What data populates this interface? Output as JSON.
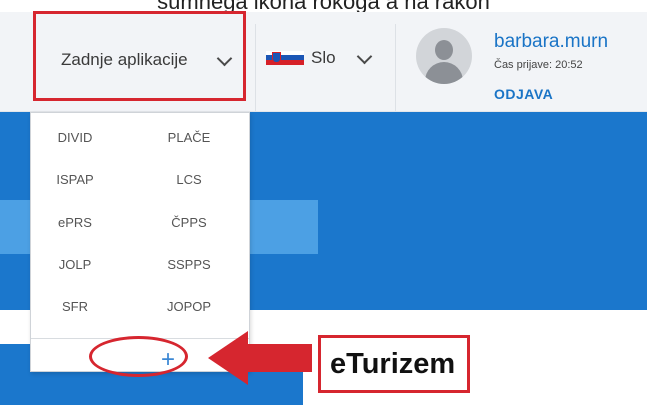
{
  "caption": "sumnega ikona rokoga a na rakon",
  "header": {
    "recent_apps_label": "Zadnje aplikacije",
    "language_label": "Slo",
    "user": {
      "username": "barbara.murn",
      "login_time": "Čas prijave: 20:52",
      "logout_label": "ODJAVA"
    }
  },
  "dropdown": {
    "apps": [
      "DIVID",
      "PLAČE",
      "ISPAP",
      "LCS",
      "ePRS",
      "ČPPS",
      "JOLP",
      "SSPPS",
      "SFR",
      "JOPOP"
    ],
    "add_symbol": "+"
  },
  "annotation": {
    "callout_label": "eTurizem"
  },
  "colors": {
    "accent_blue": "#1b77cc",
    "highlight_red": "#d6262f",
    "link_blue": "#1a74c6"
  },
  "icons": {
    "avatar": "user-avatar-icon",
    "flag": "slovenia-flag-icon",
    "chevron": "chevron-down-icon",
    "add": "plus-icon"
  }
}
